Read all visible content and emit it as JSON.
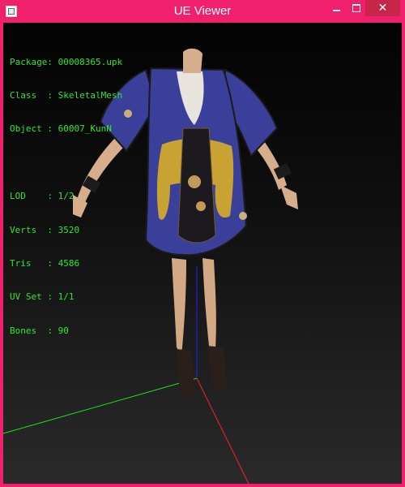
{
  "window": {
    "title": "UE Viewer",
    "accent_color": "#f0206c",
    "close_color": "#c7254a"
  },
  "info": {
    "package": {
      "label": "Package:",
      "value": "00008365.upk"
    },
    "class": {
      "label": "Class  :",
      "value": "SkeletalMesh"
    },
    "object": {
      "label": "Object :",
      "value": "60007_KunN"
    },
    "lod": {
      "label": "LOD    :",
      "value": "1/2"
    },
    "verts": {
      "label": "Verts  :",
      "value": "3520"
    },
    "tris": {
      "label": "Tris   :",
      "value": "4586"
    },
    "uvset": {
      "label": "UV Set :",
      "value": "1/1"
    },
    "bones": {
      "label": "Bones  :",
      "value": "90"
    },
    "text_color": "#2ee82e"
  },
  "scene": {
    "axis_colors": {
      "x": "#ff2020",
      "y": "#20e020",
      "z": "#2020ff"
    },
    "model_colors": {
      "robe": "#3a3f9a",
      "sash": "#c8a233",
      "skin": "#d9b18f"
    }
  },
  "icons": {
    "app": "app-icon",
    "minimize": "minimize-icon",
    "maximize": "maximize-icon",
    "close": "close-icon"
  }
}
